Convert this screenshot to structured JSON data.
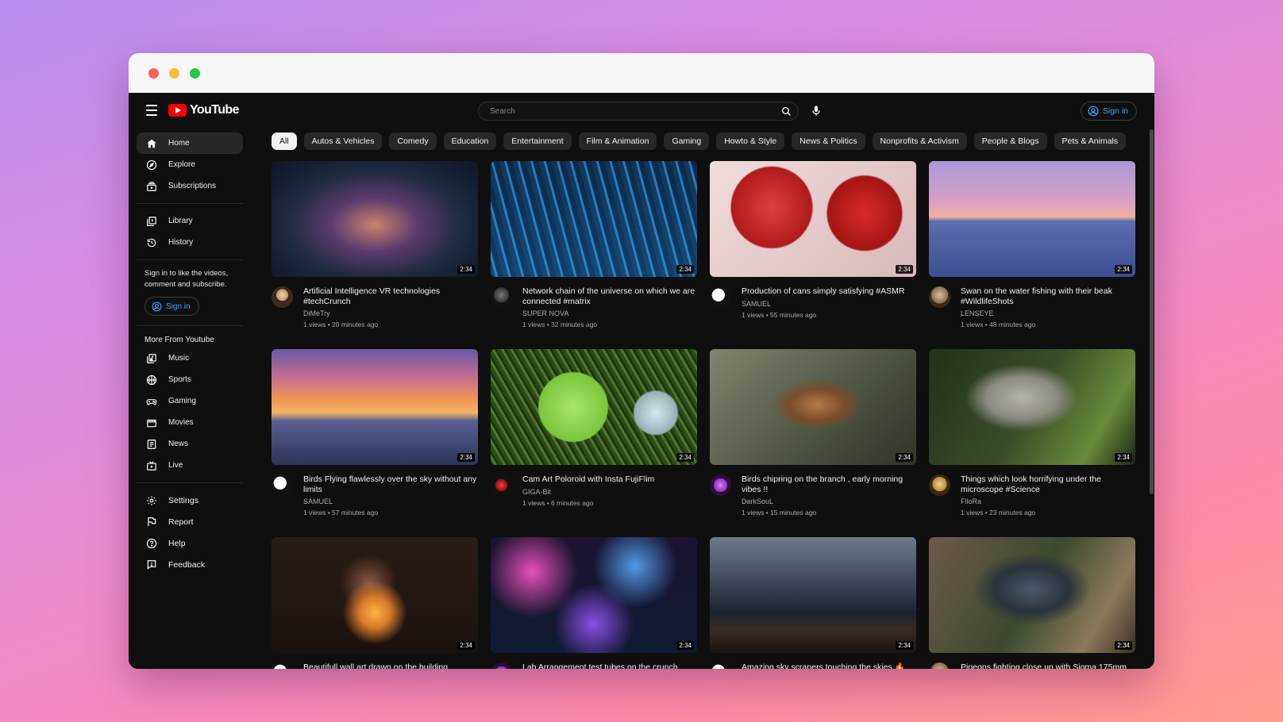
{
  "header": {
    "logo_text": "YouTube",
    "search_placeholder": "Search",
    "signin_label": "Sign in"
  },
  "sidebar": {
    "main_items": [
      {
        "label": "Home",
        "icon": "home-icon",
        "active": true
      },
      {
        "label": "Explore",
        "icon": "compass-icon"
      },
      {
        "label": "Subscriptions",
        "icon": "subscriptions-icon"
      }
    ],
    "library_items": [
      {
        "label": "Library",
        "icon": "library-icon"
      },
      {
        "label": "History",
        "icon": "history-icon"
      }
    ],
    "signin_note": "Sign in to like the videos, comment and subscribe.",
    "signin_label": "Sign in",
    "more_title": "More From Youtube",
    "more_items": [
      {
        "label": "Music",
        "icon": "music-icon"
      },
      {
        "label": "Sports",
        "icon": "sports-icon"
      },
      {
        "label": "Gaming",
        "icon": "gaming-icon"
      },
      {
        "label": "Movies",
        "icon": "movies-icon"
      },
      {
        "label": "News",
        "icon": "news-icon"
      },
      {
        "label": "Live",
        "icon": "live-icon"
      }
    ],
    "settings_items": [
      {
        "label": "Settings",
        "icon": "gear-icon"
      },
      {
        "label": "Report",
        "icon": "flag-icon"
      },
      {
        "label": "Help",
        "icon": "help-icon"
      },
      {
        "label": "Feedback",
        "icon": "feedback-icon"
      }
    ]
  },
  "chips": [
    "All",
    "Autos & Vehicles",
    "Comedy",
    "Education",
    "Entertainment",
    "Film & Animation",
    "Gaming",
    "Howto & Style",
    "News & Politics",
    "Nonprofits & Activism",
    "People & Blogs",
    "Pets & Animals"
  ],
  "videos": [
    {
      "title": "Artificial Intelligence VR technologies #techCrunch",
      "channel": "DiMeTry",
      "stats": "1 views • 20 minutes ago",
      "duration": "2:34"
    },
    {
      "title": "Network chain of the universe on which we are connected #matrix",
      "channel": "SUPER NOVA",
      "stats": "1 views • 32 minutes ago",
      "duration": "2:34"
    },
    {
      "title": "Production of cans simply satisfying #ASMR",
      "channel": "SAMUEL",
      "stats": "1 views • 55 minutes ago",
      "duration": "2:34"
    },
    {
      "title": "Swan on the water fishing with their beak #WildlifeShots",
      "channel": "LENSEYE",
      "stats": "1 views • 48 minutes ago",
      "duration": "2:34"
    },
    {
      "title": "Birds Flying flawlessly over the sky without any limits",
      "channel": "SAMUEL",
      "stats": "1 views • 57 minutes ago",
      "duration": "2:34"
    },
    {
      "title": "Cam Art Poloroid with Insta FujiFlim",
      "channel": "GIGA-Bit",
      "stats": "1 views • 6 minutes ago",
      "duration": "2:34"
    },
    {
      "title": "Birds chipring on the branch , early morning vibes !!",
      "channel": "DarkSouL",
      "stats": "1 views • 15 minutes ago",
      "duration": "2:34"
    },
    {
      "title": "Things which look horrifying under the microscope #Science",
      "channel": "FlloRa",
      "stats": "1 views • 23 minutes ago",
      "duration": "2:34"
    },
    {
      "title": "Beautifull wall art drawn on the building",
      "channel": "",
      "stats": "",
      "duration": "2:34"
    },
    {
      "title": "Lab Arrangement test tubes on the crunch",
      "channel": "",
      "stats": "",
      "duration": "2:34"
    },
    {
      "title": "Amazing sky scrapers touching the skies 🔥",
      "channel": "",
      "stats": "",
      "duration": "2:34"
    },
    {
      "title": "Pigeons fighting close up with Sigma 175mm",
      "channel": "",
      "stats": "",
      "duration": "2:34"
    }
  ]
}
